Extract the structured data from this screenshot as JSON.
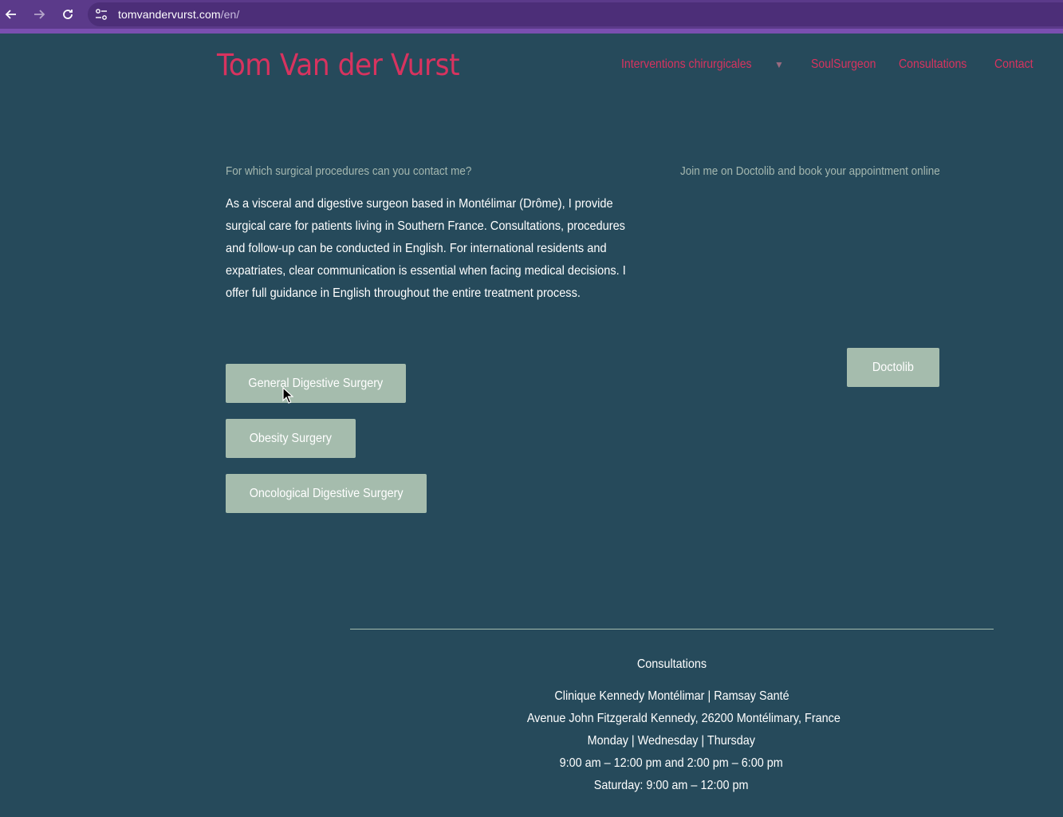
{
  "browser": {
    "url_domain": "tomvandervurst.com",
    "url_path": "/en/"
  },
  "header": {
    "site_title": "Tom Van der Vurst",
    "nav": [
      {
        "label": "Interventions chirurgicales"
      },
      {
        "label": "SoulSurgeon"
      },
      {
        "label": "Consultations"
      },
      {
        "label": "Contact"
      }
    ]
  },
  "main": {
    "left_heading": "For which surgical procedures can you contact me?",
    "intro": "As a visceral and digestive surgeon based in Montélimar (Drôme), I provide surgical care for patients living in Southern France. Consultations, procedures and follow-up can be conducted in English. For international residents and expatriates, clear communication is essential when facing medical decisions. I offer full guidance in English throughout the entire treatment process.",
    "buttons": [
      {
        "label": "General Digestive Surgery"
      },
      {
        "label": "Obesity Surgery"
      },
      {
        "label": "Oncological Digestive Surgery"
      }
    ],
    "right_heading": "Join me on Doctolib and book your appointment online",
    "doctolib_button": "Doctolib"
  },
  "footer": {
    "title": "Consultations",
    "lines": [
      "Clinique Kennedy Montélimar | Ramsay Santé",
      "Avenue John Fitzgerald Kennedy, 26200 Montélimary, France",
      "Monday | Wednesday | Thursday",
      "9:00 am – 12:00 pm and 2:00 pm – 6:00 pm",
      "Saturday: 9:00 am – 12:00 pm"
    ]
  },
  "colors": {
    "background": "#264a5b",
    "accent": "#d8335f",
    "button": "#a5bcad",
    "browser_bar": "#5b3a8a"
  }
}
